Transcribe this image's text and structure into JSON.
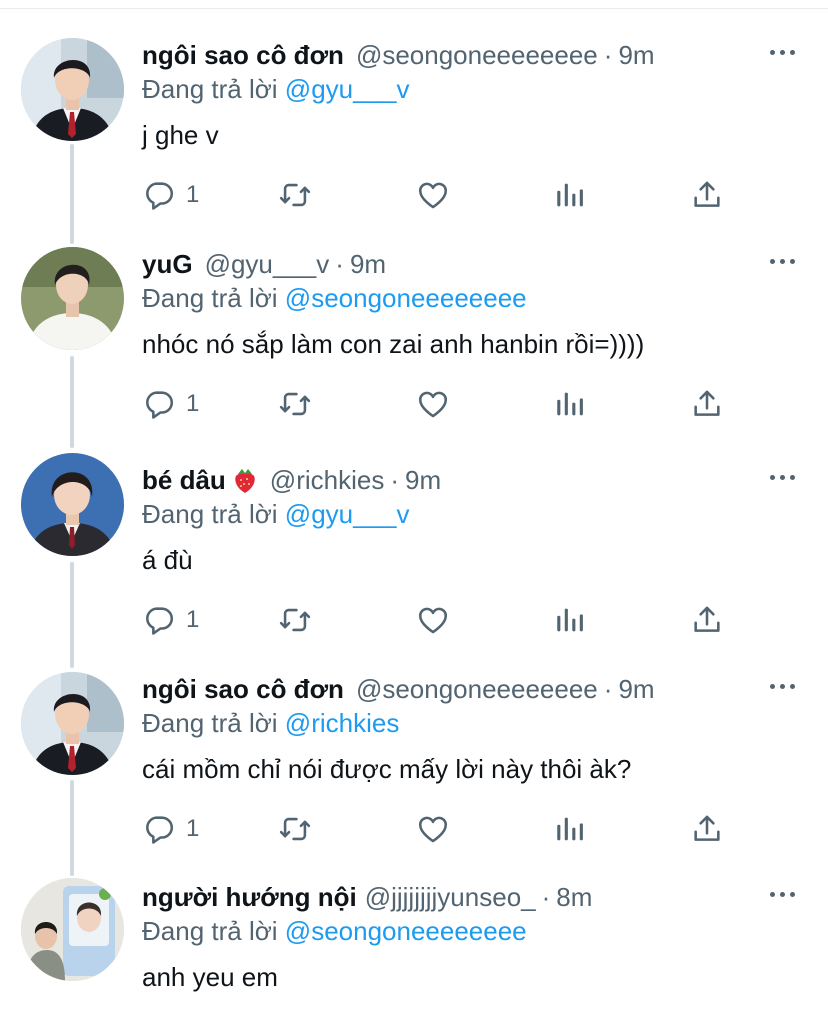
{
  "reply_prefix": "Đang trả lời",
  "colors": {
    "accent": "#1d9bf0",
    "secondary_text": "#536471",
    "thread_line": "#cfd9de"
  },
  "tweets": [
    {
      "name": "ngôi sao cô đơn",
      "handle": "@seongoneeeeeeee",
      "time": "9m",
      "replying_to": "@gyu___v",
      "text": "j ghe v",
      "reply_count": "1",
      "avatar": "avatar-boy-school-uniform"
    },
    {
      "name": "yuG",
      "handle": "@gyu___v",
      "time": "9m",
      "replying_to": "@seongoneeeeeeee",
      "text": "nhóc nó sắp làm con zai anh hanbin rồi=))))",
      "reply_count": "1",
      "avatar": "avatar-boy-white-shirt"
    },
    {
      "name": "bé dâu",
      "name_emoji": "strawberry-emoji",
      "handle": "@richkies",
      "time": "9m",
      "replying_to": "@gyu___v",
      "text": "á đù",
      "reply_count": "1",
      "avatar": "avatar-boy-blue-background"
    },
    {
      "name": "ngôi sao cô đơn",
      "handle": "@seongoneeeeeeee",
      "time": "9m",
      "replying_to": "@richkies",
      "text": "cái mồm chỉ nói được mấy lời này thôi àk?",
      "reply_count": "1",
      "avatar": "avatar-boy-school-uniform"
    },
    {
      "name": "người hướng nội",
      "handle": "@jjjjjjjjyunseo_",
      "time": "8m",
      "replying_to": "@seongoneeeeeeee",
      "text": "anh yeu em",
      "avatar": "avatar-boy-photo-card"
    }
  ]
}
